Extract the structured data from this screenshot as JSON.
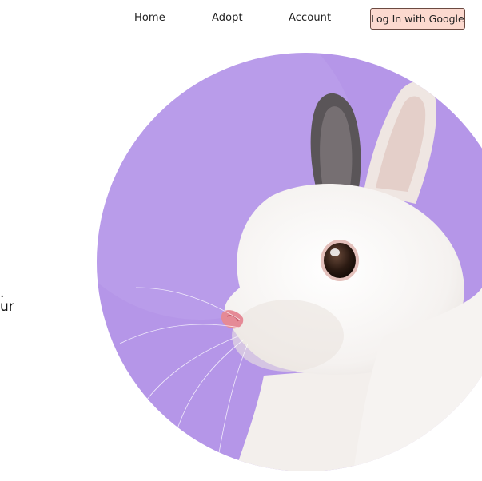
{
  "nav": {
    "links": [
      {
        "label": "Home"
      },
      {
        "label": "Adopt"
      },
      {
        "label": "Account"
      }
    ],
    "login_button_label": "Log In with Google",
    "login_button_color": "#fcd9cf"
  },
  "hero": {
    "text_fragment_1": ".",
    "text_fragment_2": "ur",
    "image_subject": "white-rabbit",
    "circle_color": "#b596e8"
  }
}
